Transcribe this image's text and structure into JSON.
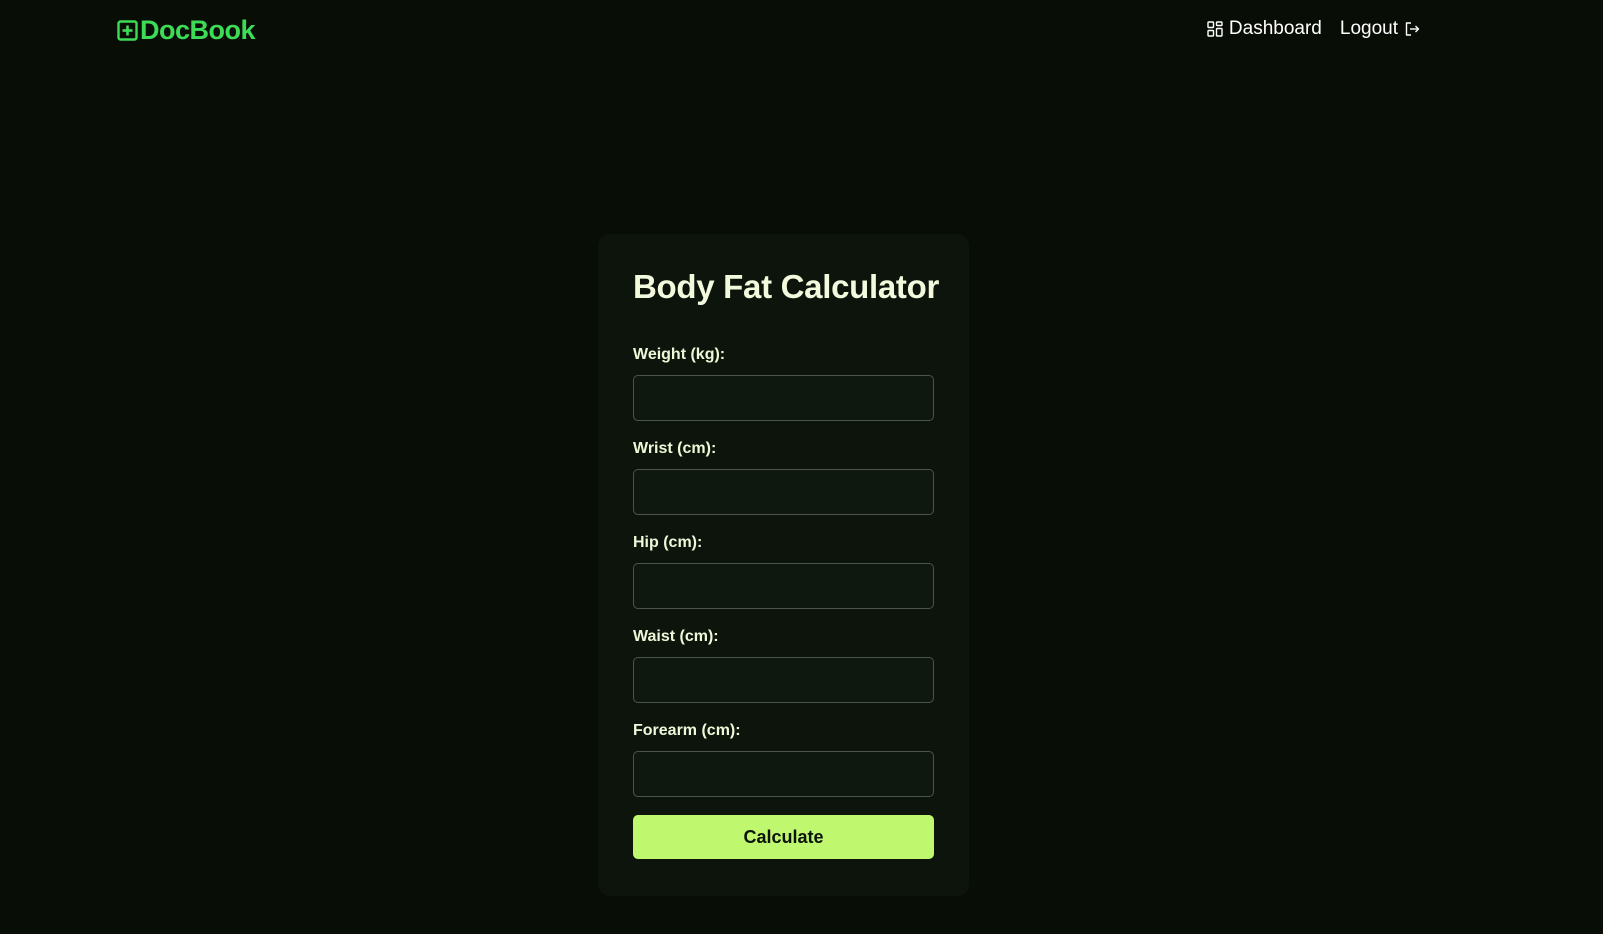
{
  "nav": {
    "brand": "DocBook",
    "brand_icon": "plus-square-icon",
    "links": [
      {
        "label": "Dashboard",
        "icon": "grid-icon"
      },
      {
        "label": "Logout",
        "icon": "logout-icon"
      }
    ]
  },
  "form": {
    "title": "Body Fat Calculator",
    "fields": [
      {
        "label": "Weight (kg):",
        "value": "",
        "placeholder": ""
      },
      {
        "label": "Wrist (cm):",
        "value": "",
        "placeholder": ""
      },
      {
        "label": "Hip (cm):",
        "value": "",
        "placeholder": ""
      },
      {
        "label": "Waist (cm):",
        "value": "",
        "placeholder": ""
      },
      {
        "label": "Forearm (cm):",
        "value": "",
        "placeholder": ""
      }
    ],
    "submit_label": "Calculate"
  },
  "colors": {
    "background": "#080e06",
    "card": "#0d140c",
    "brand": "#3ddc57",
    "accent_button": "#bff86e",
    "text": "#eef7d8"
  }
}
